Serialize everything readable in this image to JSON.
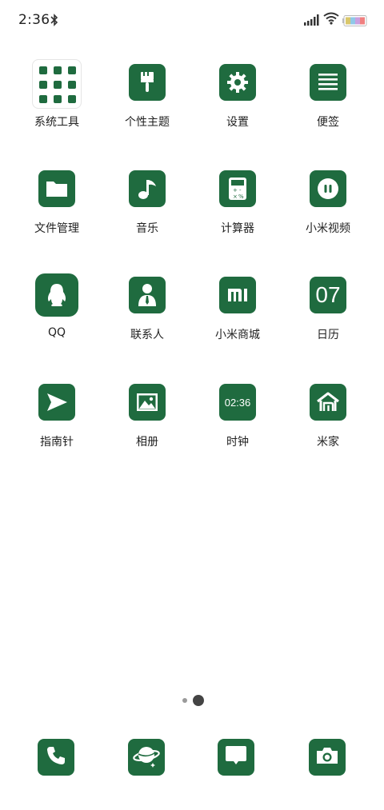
{
  "status_bar": {
    "time": "2:36",
    "bluetooth_icon": "bluetooth-icon",
    "signal_icon": "signal-icon",
    "wifi_icon": "wifi-icon",
    "battery_icon": "battery-icon"
  },
  "colors": {
    "tile": "#1f6b3f",
    "background": "#ffffff",
    "label": "#222222"
  },
  "apps": [
    {
      "label": "系统工具",
      "icon": "folder-grid-icon"
    },
    {
      "label": "个性主题",
      "icon": "paintbrush-icon"
    },
    {
      "label": "设置",
      "icon": "gear-icon"
    },
    {
      "label": "便签",
      "icon": "notes-lines-icon"
    },
    {
      "label": "文件管理",
      "icon": "folder-icon"
    },
    {
      "label": "音乐",
      "icon": "music-note-icon"
    },
    {
      "label": "计算器",
      "icon": "calculator-icon"
    },
    {
      "label": "小米视频",
      "icon": "video-pause-icon"
    },
    {
      "label": "QQ",
      "icon": "qq-penguin-icon"
    },
    {
      "label": "联系人",
      "icon": "contact-person-icon"
    },
    {
      "label": "小米商城",
      "icon": "mi-logo-icon",
      "tile_text": "mi"
    },
    {
      "label": "日历",
      "icon": "calendar-icon",
      "tile_text": "07"
    },
    {
      "label": "指南针",
      "icon": "compass-arrow-icon"
    },
    {
      "label": "相册",
      "icon": "gallery-image-icon"
    },
    {
      "label": "时钟",
      "icon": "clock-icon",
      "tile_text": "02:36"
    },
    {
      "label": "米家",
      "icon": "home-icon"
    }
  ],
  "pager": {
    "pages": 2,
    "current_page": 2
  },
  "dock": [
    {
      "icon": "phone-icon"
    },
    {
      "icon": "browser-planet-icon"
    },
    {
      "icon": "messages-icon"
    },
    {
      "icon": "camera-icon"
    }
  ]
}
